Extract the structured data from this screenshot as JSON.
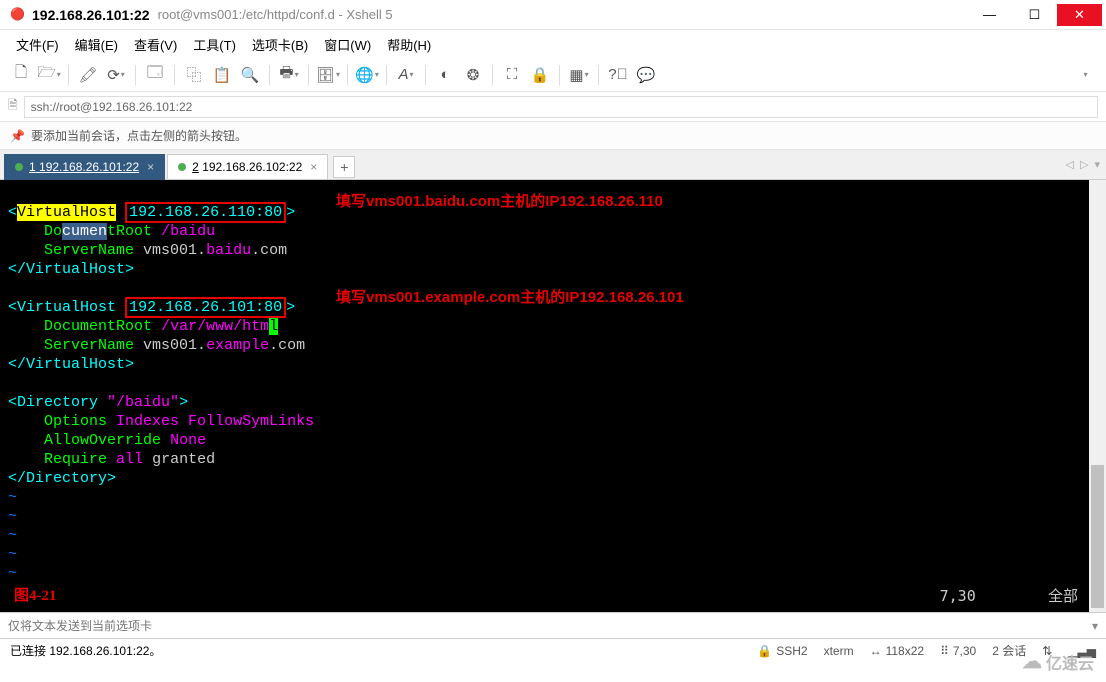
{
  "title": {
    "host": "192.168.26.101:22",
    "path": "root@vms001:/etc/httpd/conf.d - Xshell 5"
  },
  "menu": {
    "file": "文件(F)",
    "edit": "编辑(E)",
    "view": "查看(V)",
    "tools": "工具(T)",
    "tabs": "选项卡(B)",
    "window": "窗口(W)",
    "help": "帮助(H)"
  },
  "addr": {
    "url": "ssh://root@192.168.26.101:22"
  },
  "info": {
    "text": "要添加当前会话，点击左侧的箭头按钮。"
  },
  "tabs": [
    {
      "num": "1",
      "label": "192.168.26.101:22",
      "active": true
    },
    {
      "num": "2",
      "label": "192.168.26.102:22",
      "active": false
    }
  ],
  "term": {
    "vh1": {
      "open": "VirtualHost",
      "ip": "192.168.26.110:80",
      "docroot_k": "DocumentRoot",
      "docroot_v": "/baidu",
      "sname_k": "ServerName",
      "sname_v_pre": "vms001.",
      "sname_v_mid": "baidu",
      "sname_v_post": ".com",
      "close": "VirtualHost",
      "annot": "填写vms001.baidu.com主机的IP192.168.26.110"
    },
    "vh2": {
      "open": "VirtualHost",
      "ip": "192.168.26.101:80",
      "docroot_k": "DocumentRoot",
      "docroot_v": "/var/www/htm",
      "docroot_cursor": "l",
      "sname_k": "ServerName",
      "sname_v_pre": "vms001.",
      "sname_v_mid": "example",
      "sname_v_post": ".com",
      "close": "VirtualHost",
      "annot": "填写vms001.example.com主机的IP192.168.26.101"
    },
    "dir": {
      "open": "Directory",
      "path": "\"/baidu\"",
      "opt_k": "Options",
      "opt_v": "Indexes FollowSymLinks",
      "allow_k": "AllowOverride",
      "allow_v": "None",
      "req_k": "Require",
      "req_mid": "all",
      "req_v": "granted",
      "close": "Directory"
    },
    "fig": "图4-21",
    "status_pos": "7,30",
    "status_range": "全部"
  },
  "input": {
    "placeholder": "仅将文本发送到当前选项卡"
  },
  "status": {
    "conn": "已连接 192.168.26.101:22。",
    "proto": "SSH2",
    "term": "xterm",
    "size": "118x22",
    "pos": "7,30",
    "sessions": "2 会话"
  },
  "watermark": "亿速云"
}
